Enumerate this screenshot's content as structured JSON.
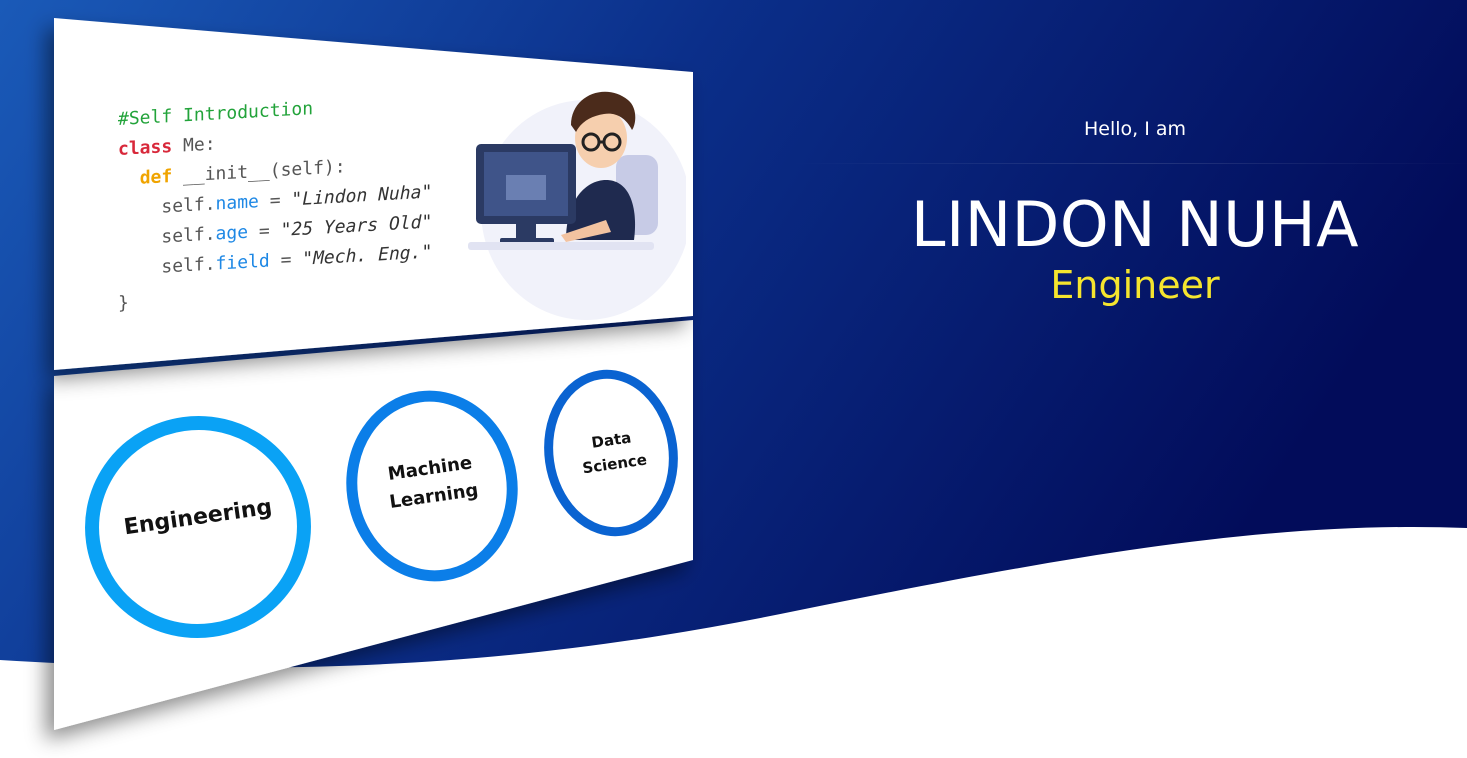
{
  "hero": {
    "greeting": "Hello, I am",
    "name": "LINDON NUHA",
    "role": "Engineer"
  },
  "code": {
    "comment": "#Self Introduction",
    "class_kw": "class",
    "class_name": " Me:",
    "def_kw": "def",
    "init": " __init__(self):",
    "self1": "self.",
    "attr_name": "name",
    "eq1": " = ",
    "val_name": "\"Lindon Nuha\"",
    "self2": "self.",
    "attr_age": "age",
    "eq2": " = ",
    "val_age": "\"25 Years Old\"",
    "self3": "self.",
    "attr_field": "field",
    "eq3": " = ",
    "val_field": "\"Mech. Eng.\"",
    "close": "}"
  },
  "skills": [
    {
      "label": "Engineering"
    },
    {
      "label": "Machine\nLearning"
    },
    {
      "label": "Data\nScience"
    }
  ],
  "colors": {
    "bg_dark": "#020e5e",
    "bg_mid": "#0a2d87",
    "bg_light": "#1450b0",
    "accent_yellow": "#f5e52e",
    "ring_light": "#0aa2f5",
    "ring_mid": "#0b7ee8",
    "ring_dark": "#0a63d1"
  }
}
